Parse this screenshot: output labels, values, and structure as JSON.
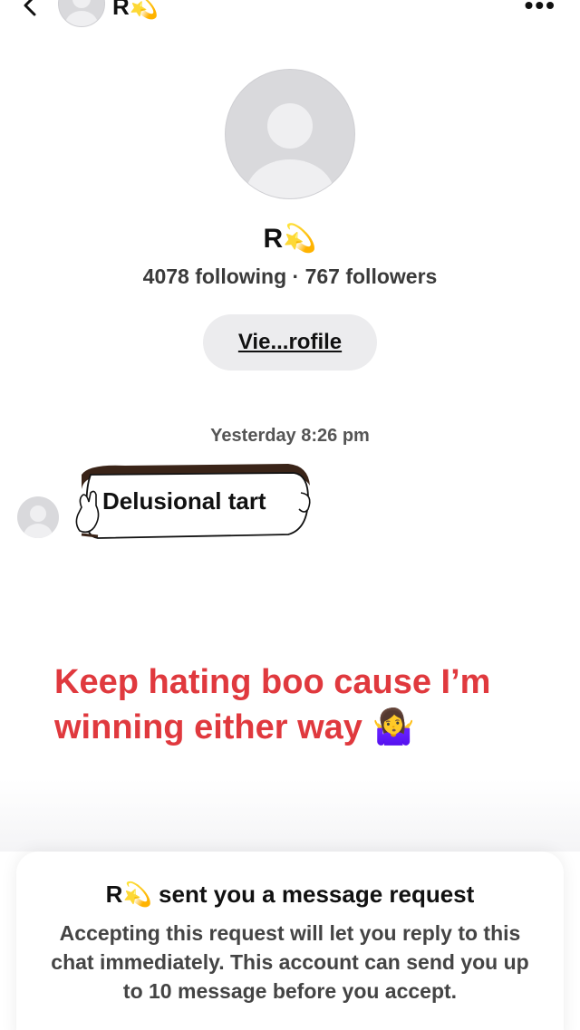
{
  "header": {
    "name": "R💫",
    "more_label": "•••"
  },
  "profile": {
    "name": "R💫",
    "stats": "4078 following · 767 followers",
    "view_profile_label": "Vie...rofile"
  },
  "chat": {
    "timestamp": "Yesterday 8:26 pm",
    "messages": [
      {
        "text": "Delusional tart"
      }
    ]
  },
  "overlay": {
    "caption": "Keep hating boo cause I’m winning either way 🤷‍♀️"
  },
  "request": {
    "title": "R💫 sent you a message request",
    "body": "Accepting this request will let you reply to this chat immediately. This account can send you up to 10 message before you accept."
  },
  "colors": {
    "caption": "#e0393e",
    "button_bg": "#ececee",
    "avatar_bg": "#d9d9dc"
  }
}
